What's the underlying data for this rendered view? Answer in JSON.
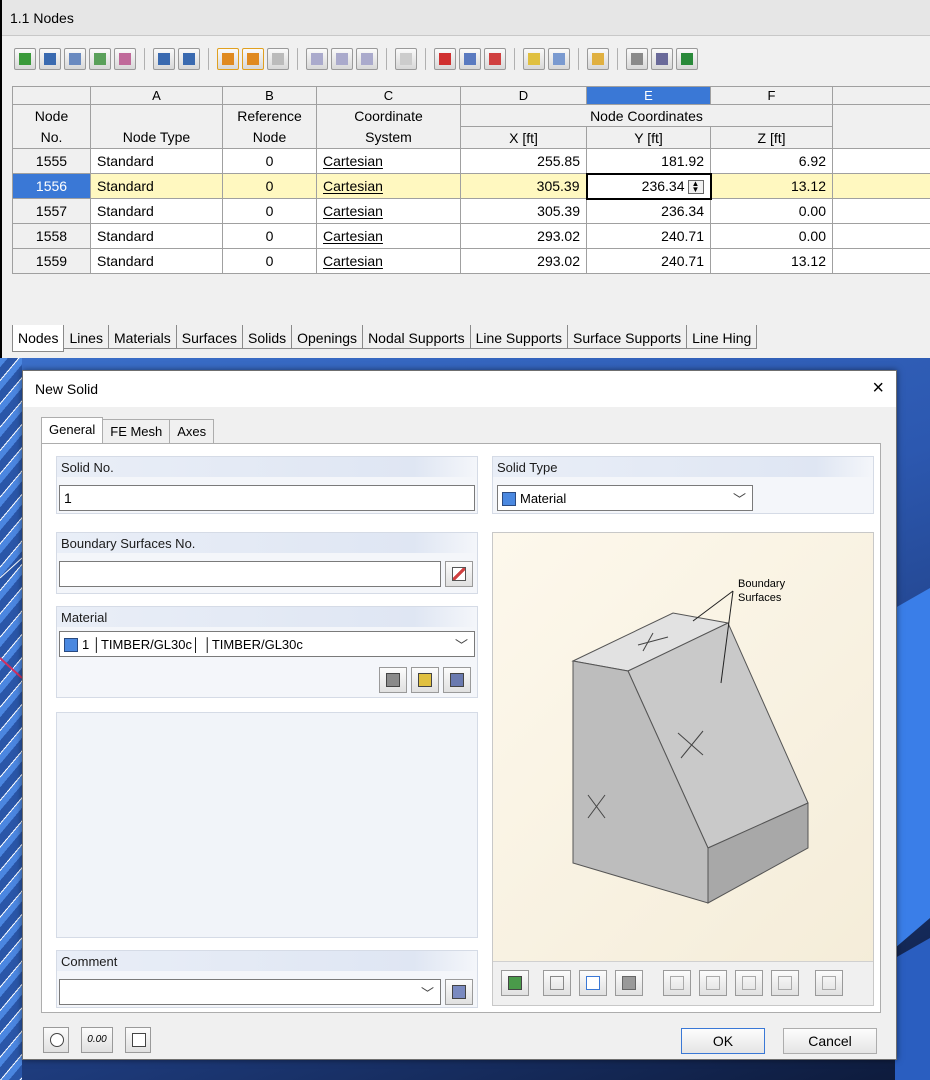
{
  "table_window": {
    "title": "1.1 Nodes",
    "column_letters": [
      "A",
      "B",
      "C",
      "D",
      "E",
      "F"
    ],
    "header": {
      "node_no_line1": "Node",
      "node_no_line2": "No.",
      "node_type": "Node Type",
      "ref_node_line1": "Reference",
      "ref_node_line2": "Node",
      "coord_sys_line1": "Coordinate",
      "coord_sys_line2": "System",
      "node_coords": "Node Coordinates",
      "x": "X [ft]",
      "y": "Y [ft]",
      "z": "Z [ft]"
    },
    "rows": [
      {
        "no": "1555",
        "type": "Standard",
        "ref": "0",
        "cs": "Cartesian",
        "x": "255.85",
        "y": "181.92",
        "z": "6.92"
      },
      {
        "no": "1556",
        "type": "Standard",
        "ref": "0",
        "cs": "Cartesian",
        "x": "305.39",
        "y": "236.34",
        "z": "13.12"
      },
      {
        "no": "1557",
        "type": "Standard",
        "ref": "0",
        "cs": "Cartesian",
        "x": "305.39",
        "y": "236.34",
        "z": "0.00"
      },
      {
        "no": "1558",
        "type": "Standard",
        "ref": "0",
        "cs": "Cartesian",
        "x": "293.02",
        "y": "240.71",
        "z": "0.00"
      },
      {
        "no": "1559",
        "type": "Standard",
        "ref": "0",
        "cs": "Cartesian",
        "x": "293.02",
        "y": "240.71",
        "z": "13.12"
      }
    ],
    "sheet_tabs": [
      "Nodes",
      "Lines",
      "Materials",
      "Surfaces",
      "Solids",
      "Openings",
      "Nodal Supports",
      "Line Supports",
      "Surface Supports",
      "Line Hing"
    ]
  },
  "dialog": {
    "title": "New Solid",
    "close_label": "×",
    "tabs": [
      "General",
      "FE Mesh",
      "Axes"
    ],
    "solid_no_label": "Solid No.",
    "solid_no_value": "1",
    "solid_type_label": "Solid Type",
    "solid_type_value": "Material",
    "boundary_label": "Boundary Surfaces No.",
    "boundary_value": "",
    "material_label": "Material",
    "material_value": "1 │TIMBER/GL30c│ │TIMBER/GL30c",
    "comment_label": "Comment",
    "comment_value": "",
    "preview_annotation_line1": "Boundary",
    "preview_annotation_line2": "Surfaces",
    "ok_label": "OK",
    "cancel_label": "Cancel",
    "units_button_label": "0.00"
  },
  "colors": {
    "selection_blue": "#3a78d6",
    "current_row": "#fff8c0",
    "material_swatch": "#4a88e0"
  }
}
